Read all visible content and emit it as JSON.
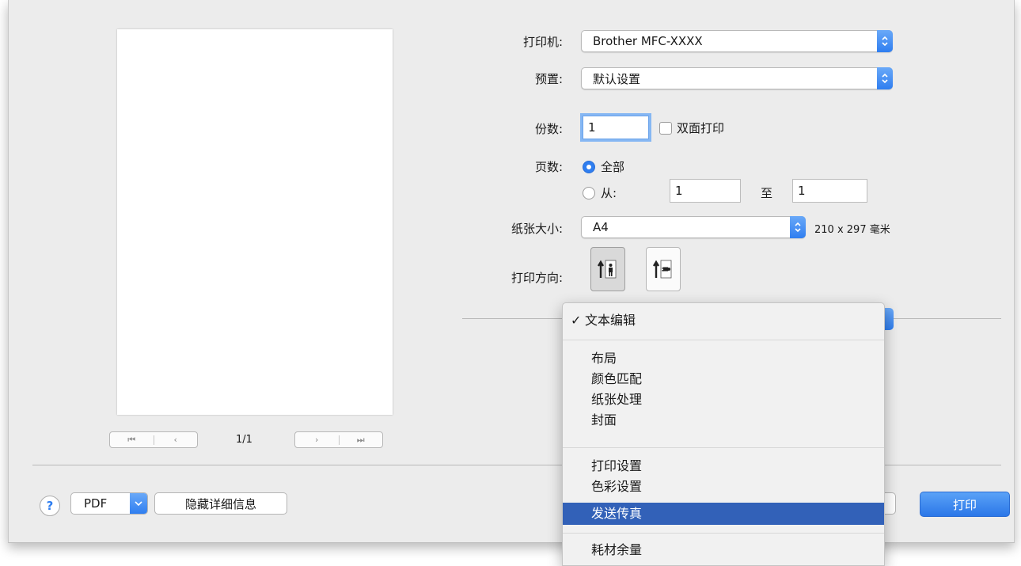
{
  "colors": {
    "accent": "#2f7ef0",
    "menu_highlight": "#3261b8"
  },
  "preview": {
    "page_count": "1/1"
  },
  "printer": {
    "label": "打印机:",
    "value": "Brother MFC-XXXX"
  },
  "presets": {
    "label": "预置:",
    "value": "默认设置"
  },
  "copies": {
    "label": "份数:",
    "value": "1",
    "duplex_label": "双面打印",
    "duplex_checked": false
  },
  "pages": {
    "label": "页数:",
    "all_label": "全部",
    "from_label": "从:",
    "to_label": "至",
    "from_value": "1",
    "to_value": "1",
    "selected": "all"
  },
  "paper_size": {
    "label": "纸张大小:",
    "value": "A4",
    "dimensions": "210 x 297 毫米"
  },
  "orientation": {
    "label": "打印方向:",
    "selected": "portrait",
    "options": [
      "portrait-icon",
      "landscape-icon"
    ]
  },
  "menu": {
    "checked_mark": "✓",
    "checked_item": "文本编辑",
    "group1": [
      "布局",
      "颜色匹配",
      "纸张处理",
      "封面"
    ],
    "group2": [
      "打印设置",
      "色彩设置",
      "发送传真"
    ],
    "group3": [
      "耗材余量"
    ],
    "highlighted": "发送传真"
  },
  "bottom": {
    "help": "?",
    "pdf_label": "PDF",
    "hide_details_label": "隐藏详细信息",
    "print_label": "打印"
  }
}
